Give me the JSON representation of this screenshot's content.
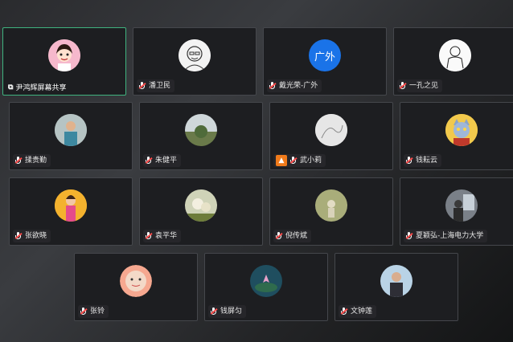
{
  "participants": [
    {
      "name": "尹鸿辉屏幕共享",
      "highlight": "屏幕",
      "avatar": "person-illustration-icon",
      "active": true,
      "share": true
    },
    {
      "name": "潘卫民",
      "avatar": "sketch-portrait-icon"
    },
    {
      "name": "戴光荣-广外",
      "avatar_text": "广外",
      "avatar_color": "#1a73e8"
    },
    {
      "name": "一孔之见",
      "avatar": "line-drawing-icon"
    },
    {
      "name": "揉贵勤",
      "avatar": "person-photo-icon"
    },
    {
      "name": "朱健平",
      "avatar": "landscape-photo-icon"
    },
    {
      "name": "武小莉",
      "avatar": "pencil-sketch-icon",
      "camera_badge": true
    },
    {
      "name": "钱耘云",
      "avatar": "cartoon-cat-icon"
    },
    {
      "name": "张欲晓",
      "avatar": "woman-photo-icon"
    },
    {
      "name": "袁平华",
      "avatar": "flower-photo-icon"
    },
    {
      "name": "倪传斌",
      "avatar": "outdoor-photo-icon"
    },
    {
      "name": "夏颖弘-上海电力大学",
      "avatar": "room-photo-icon"
    },
    {
      "name": "张铃",
      "avatar": "cartoon-face-icon"
    },
    {
      "name": "钱屏匀",
      "avatar": "lotus-photo-icon"
    },
    {
      "name": "文钟莲",
      "avatar": "portrait-photo-icon"
    }
  ]
}
